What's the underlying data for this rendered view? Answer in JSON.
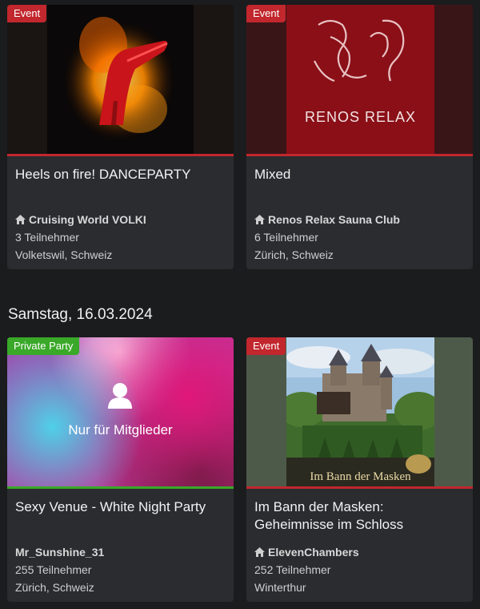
{
  "events_top": [
    {
      "badge": "Event",
      "title": "Heels on fire! DANCEPARTY",
      "host": "Cruising World VOLKI",
      "participants": "3 Teilnehmer",
      "location": "Volketswil, Schweiz"
    },
    {
      "badge": "Event",
      "title": "Mixed",
      "image_text": "RENOS RELAX",
      "host": "Renos Relax Sauna Club",
      "participants": "6 Teilnehmer",
      "location": "Zürich, Schweiz"
    }
  ],
  "day_heading": "Samstag, 16.03.2024",
  "events_bottom": [
    {
      "badge": "Private Party",
      "title": "Sexy Venue - White Night Party",
      "image_text": "Nur für Mitglieder",
      "host": "Mr_Sunshine_31",
      "participants": "255 Teilnehmer",
      "location": "Zürich, Schweiz"
    },
    {
      "badge": "Event",
      "title": "Im Bann der Masken: Geheimnisse im Schloss",
      "image_text": "Im Bann der Masken",
      "host": "ElevenChambers",
      "participants": "252 Teilnehmer",
      "location": "Winterthur"
    }
  ],
  "colors": {
    "event_badge": "#c1272d",
    "private_badge": "#3aa829",
    "background": "#1b1c1e",
    "card": "#2a2c30"
  }
}
